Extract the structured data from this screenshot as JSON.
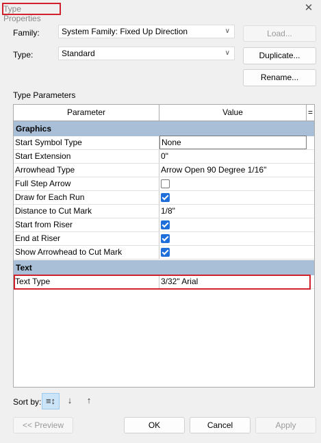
{
  "window": {
    "title": "Type Properties",
    "close_glyph": "✕"
  },
  "family": {
    "label": "Family:",
    "value": "System Family: Fixed Up Direction"
  },
  "type": {
    "label": "Type:",
    "value": "Standard"
  },
  "buttons": {
    "load": "Load...",
    "duplicate": "Duplicate...",
    "rename": "Rename..."
  },
  "type_parameters_label": "Type Parameters",
  "grid": {
    "col_parameter": "Parameter",
    "col_value": "Value",
    "col_extra": "=",
    "groups": [
      {
        "name": "Graphics",
        "rows": [
          {
            "param": "Start Symbol Type",
            "value": "None",
            "kind": "edit"
          },
          {
            "param": "Start Extension",
            "value": "0\"",
            "kind": "text"
          },
          {
            "param": "Arrowhead Type",
            "value": "Arrow Open 90 Degree 1/16\"",
            "kind": "text"
          },
          {
            "param": "Full Step Arrow",
            "checked": false,
            "kind": "check"
          },
          {
            "param": "Draw for Each Run",
            "checked": true,
            "kind": "check"
          },
          {
            "param": "Distance to Cut Mark",
            "value": "1/8\"",
            "kind": "text"
          },
          {
            "param": "Start from Riser",
            "checked": true,
            "kind": "check"
          },
          {
            "param": "End at Riser",
            "checked": true,
            "kind": "check"
          },
          {
            "param": "Show Arrowhead to Cut Mark",
            "checked": true,
            "kind": "check"
          }
        ]
      },
      {
        "name": "Text",
        "rows": [
          {
            "param": "Text Type",
            "value": "3/32\" Arial",
            "kind": "text"
          }
        ]
      }
    ]
  },
  "sort": {
    "label": "Sort by:"
  },
  "footer": {
    "preview": "<< Preview",
    "ok": "OK",
    "cancel": "Cancel",
    "apply": "Apply"
  },
  "icons": [
    "close-icon",
    "chevron-down-icon",
    "sort-by-group-icon",
    "sort-ascending-icon",
    "sort-descending-icon"
  ],
  "colors": {
    "highlight": "#d0202c",
    "group_header": "#a9bfd8",
    "checkbox": "#1e6fd9"
  }
}
